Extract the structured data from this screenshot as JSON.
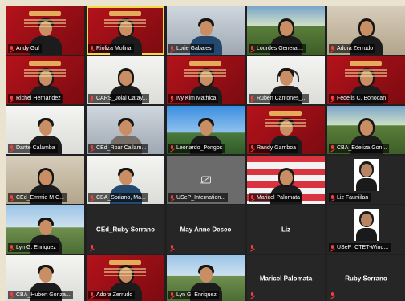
{
  "rows": [
    [
      {
        "name": "Andy Gul",
        "bg": "bg-red",
        "person": "dark"
      },
      {
        "name": "Rioliza Molina",
        "bg": "bg-red",
        "person": "long",
        "active": true
      },
      {
        "name": "Lorie Gabales",
        "bg": "bg-room",
        "person": "blue"
      },
      {
        "name": "Lourdes General...",
        "bg": "bg-trees",
        "person": "long"
      },
      {
        "name": "Adora Zerrudo",
        "bg": "bg-office",
        "person": "long"
      }
    ],
    [
      {
        "name": "Richel Hernandez",
        "bg": "bg-red",
        "person": "long"
      },
      {
        "name": "CARS_Jolai Catay...",
        "bg": "bg-white",
        "person": "long"
      },
      {
        "name": "Ivy Kim Mathica",
        "bg": "bg-red",
        "person": "long"
      },
      {
        "name": "Ruben Cantones_...",
        "bg": "bg-white",
        "person": "dark",
        "headset": true
      },
      {
        "name": "Fedelis C. Bonocan",
        "bg": "bg-red",
        "person": "long"
      }
    ],
    [
      {
        "name": "Dante Calamba",
        "bg": "bg-white",
        "person": "dark"
      },
      {
        "name": "CEd_Roar Callam...",
        "bg": "bg-room",
        "person": "gray"
      },
      {
        "name": "Leonardo_Pongos",
        "bg": "bg-sky",
        "person": "dark"
      },
      {
        "name": "Randy Gamboa",
        "bg": "bg-red",
        "person": "dark"
      },
      {
        "name": "CBA_Edeliza Gon...",
        "bg": "bg-trees",
        "person": "long"
      }
    ],
    [
      {
        "name": "CEd_Emmie M C...",
        "bg": "bg-office",
        "person": "long"
      },
      {
        "name": "CBA_Soriano, Ma...",
        "bg": "bg-white",
        "person": "blue"
      },
      {
        "name": "USeP_Internation...",
        "bg": "bg-gray",
        "camoff": true
      },
      {
        "name": "Maricel Palomata",
        "bg": "bg-flag",
        "person": "long"
      },
      {
        "name": "Liz Fauniilan",
        "bg": "bg-blank",
        "photo": true
      }
    ],
    [
      {
        "name": "Lyn G. Enriquez",
        "bg": "bg-outdoor",
        "person": "dark"
      },
      {
        "center": "CEd_Ruby Serrano",
        "bg": "bg-blank"
      },
      {
        "center": "May Anne Deseo",
        "bg": "bg-blank"
      },
      {
        "center": "Liz",
        "bg": "bg-blank"
      },
      {
        "name": "USeP_CTET-Wind...",
        "bg": "bg-blank",
        "photo": true
      }
    ],
    [
      {
        "name": "CBA_Hubert Gonza...",
        "bg": "bg-white",
        "person": "dark"
      },
      {
        "name": "Adora Zerrudo",
        "bg": "bg-red",
        "person": "long"
      },
      {
        "name": "Lyn G. Enriquez",
        "bg": "bg-outdoor",
        "person": "dark"
      },
      {
        "center": "Maricel Palomata",
        "bg": "bg-blank"
      },
      {
        "center": "Ruby Serrano",
        "bg": "bg-blank"
      }
    ]
  ]
}
